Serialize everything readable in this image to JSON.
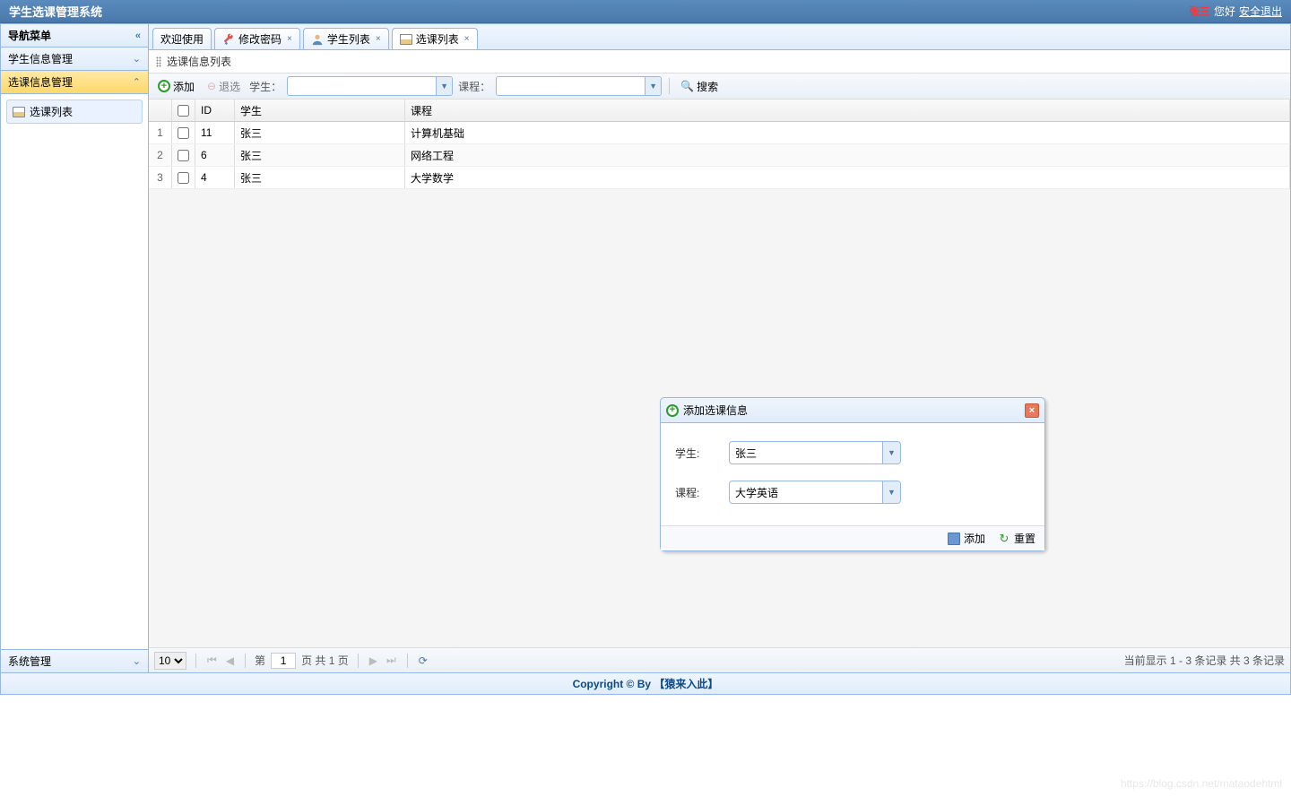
{
  "header": {
    "title": "学生选课管理系统",
    "user_name": "张三",
    "greeting": "您好",
    "logout": "安全退出"
  },
  "sidebar": {
    "title": "导航菜单",
    "items": [
      {
        "label": "学生信息管理",
        "active": false
      },
      {
        "label": "选课信息管理",
        "active": true
      }
    ],
    "nav_item": "选课列表",
    "bottom_item": "系统管理"
  },
  "tabs": [
    {
      "label": "欢迎使用",
      "closable": false
    },
    {
      "label": "修改密码",
      "closable": true,
      "icon": "wrench"
    },
    {
      "label": "学生列表",
      "closable": true,
      "icon": "user"
    },
    {
      "label": "选课列表",
      "closable": true,
      "icon": "book",
      "active": true
    }
  ],
  "panel_title": "选课信息列表",
  "toolbar": {
    "add": "添加",
    "remove": "退选",
    "student_label": "学生：",
    "course_label": "课程：",
    "search": "搜索"
  },
  "grid": {
    "columns": {
      "id": "ID",
      "student": "学生",
      "course": "课程"
    },
    "rows": [
      {
        "num": "1",
        "id": "11",
        "student": "张三",
        "course": "计算机基础"
      },
      {
        "num": "2",
        "id": "6",
        "student": "张三",
        "course": "网络工程"
      },
      {
        "num": "3",
        "id": "4",
        "student": "张三",
        "course": "大学数学"
      }
    ]
  },
  "pager": {
    "page_size": "10",
    "page_prefix": "第",
    "page_value": "1",
    "page_suffix": "页 共 1 页",
    "display_info": "当前显示 1 - 3 条记录 共 3 条记录"
  },
  "dialog": {
    "title": "添加选课信息",
    "student_label": "学生:",
    "student_value": "张三",
    "course_label": "课程:",
    "course_value": "大学英语",
    "add_btn": "添加",
    "reset_btn": "重置"
  },
  "footer": "Copyright © By 【猿来入此】",
  "watermark": "https://blog.csdn.net/mataodehtml"
}
